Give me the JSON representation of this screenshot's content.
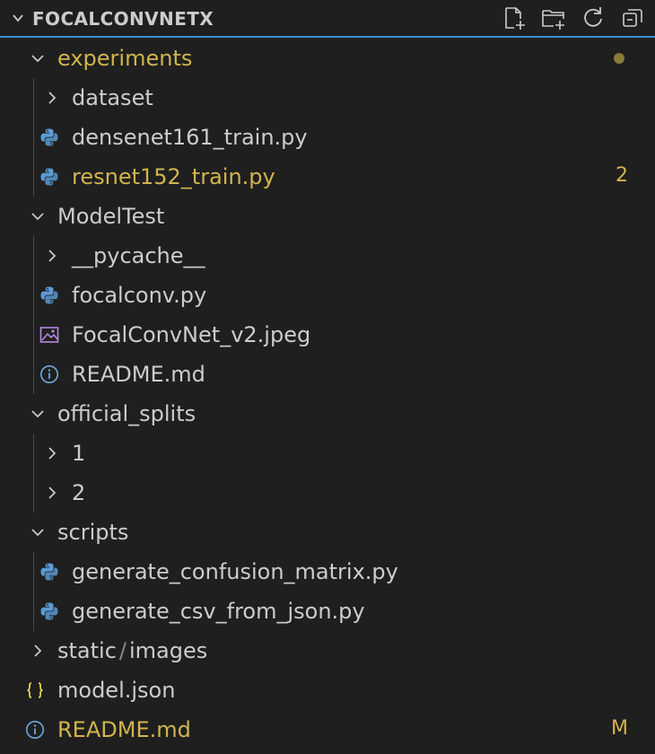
{
  "header": {
    "title": "FOCALCONVNETX",
    "actions": [
      "new-file-icon",
      "new-folder-icon",
      "refresh-icon",
      "collapse-all-icon"
    ]
  },
  "tree": {
    "experiments": {
      "label": "experiments",
      "dataset": "dataset",
      "densenet": "densenet161_train.py",
      "resnet": "resnet152_train.py",
      "resnet_badge": "2"
    },
    "modeltest": {
      "label": "ModelTest",
      "pycache": "__pycache__",
      "focalconv": "focalconv.py",
      "jpeg": "FocalConvNet_v2.jpeg",
      "readme": "README.md"
    },
    "official_splits": {
      "label": "official_splits",
      "one": "1",
      "two": "2"
    },
    "scripts": {
      "label": "scripts",
      "confusion": "generate_confusion_matrix.py",
      "csv": "generate_csv_from_json.py"
    },
    "static": {
      "part1": "static",
      "sep": "/",
      "part2": "images"
    },
    "model_json": "model.json",
    "readme_root": "README.md",
    "readme_root_badge": "M"
  },
  "colors": {
    "background": "#1f1f1f",
    "text": "#cccccc",
    "modified": "#d1b44e",
    "accent": "#3f8fd8",
    "python_icon": "#5b9bd5",
    "json_icon": "#e8d44d",
    "info_icon": "#6fa8dc",
    "image_icon": "#b48ae0"
  }
}
